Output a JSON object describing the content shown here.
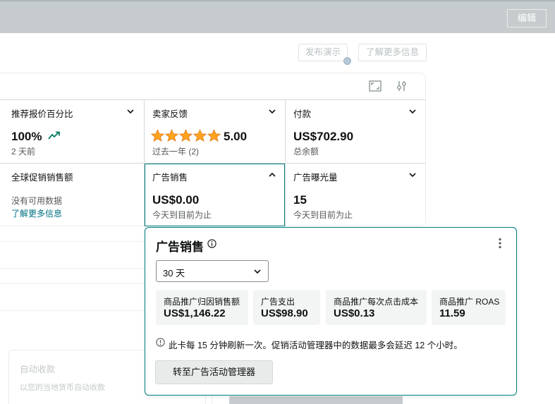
{
  "topbar": {
    "edit_label": "编辑"
  },
  "ghost_buttons": {
    "publish_demo": "发布演示",
    "learn_more": "了解更多信息"
  },
  "tiles": {
    "bid_pct": {
      "title": "推荐报价百分比",
      "value": "100%",
      "sub": "2 天前"
    },
    "feedback": {
      "title": "卖家反馈",
      "value": "5.00",
      "sub": "过去一年 (2)",
      "stars": 5
    },
    "payments": {
      "title": "付款",
      "value": "US$702.90",
      "sub": "总余额"
    },
    "global_promo": {
      "title": "全球促销销售额",
      "sub": "没有可用数据",
      "link": "了解更多信息"
    },
    "ad_sales": {
      "title": "广告销售",
      "value": "US$0.00",
      "sub": "今天到目前为止"
    },
    "ad_impressions": {
      "title": "广告曝光量",
      "value": "15",
      "sub": "今天到目前为止"
    }
  },
  "popover": {
    "title": "广告销售",
    "select_value": "30 天",
    "metrics": [
      {
        "label": "商品推广归因销售额",
        "value": "US$1,146.22"
      },
      {
        "label": "广告支出",
        "value": "US$98.90"
      },
      {
        "label": "商品推广每次点击成本",
        "value": "US$0.13"
      },
      {
        "label": "商品推广 ROAS",
        "value": "11.59"
      }
    ],
    "note": "此卡每 15 分钟刷新一次。促销活动管理器中的数据最多会延迟 12 个小时。",
    "button_label": "转至广告活动管理器"
  },
  "background_card": {
    "title": "自动收款",
    "sub": "以您的当地货币自动收款"
  },
  "colors": {
    "accent": "#017e7e",
    "link": "#007185",
    "star": "#ffa41c",
    "trend": "#067d62"
  }
}
